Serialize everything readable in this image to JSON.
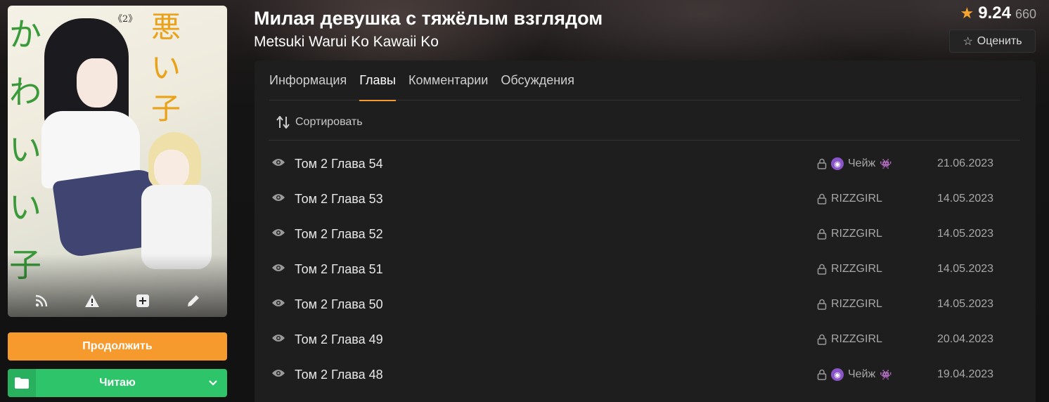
{
  "title": {
    "ru": "Милая девушка с тяжёлым взглядом",
    "en": "Metsuki Warui Ko Kawaii Ko"
  },
  "rating": {
    "score": "9.24",
    "count": "660",
    "rate_label": "Оценить"
  },
  "buttons": {
    "continue": "Продолжить",
    "reading": "Читаю"
  },
  "cover": {
    "icons": [
      "rss-icon",
      "report-icon",
      "add-icon",
      "edit-icon"
    ],
    "vol": "《2》"
  },
  "tabs": [
    {
      "label": "Информация",
      "active": false
    },
    {
      "label": "Главы",
      "active": true
    },
    {
      "label": "Комментарии",
      "active": false
    },
    {
      "label": "Обсуждения",
      "active": false
    }
  ],
  "sort_label": "Сортировать",
  "chapters": [
    {
      "name": "Том 2 Глава 54",
      "user": "Чейж",
      "date": "21.06.2023",
      "emoji": true
    },
    {
      "name": "Том 2 Глава 53",
      "user": "RIZZGIRL",
      "date": "14.05.2023",
      "emoji": false
    },
    {
      "name": "Том 2 Глава 52",
      "user": "RIZZGIRL",
      "date": "14.05.2023",
      "emoji": false
    },
    {
      "name": "Том 2 Глава 51",
      "user": "RIZZGIRL",
      "date": "14.05.2023",
      "emoji": false
    },
    {
      "name": "Том 2 Глава 50",
      "user": "RIZZGIRL",
      "date": "14.05.2023",
      "emoji": false
    },
    {
      "name": "Том 2 Глава 49",
      "user": "RIZZGIRL",
      "date": "20.04.2023",
      "emoji": false
    },
    {
      "name": "Том 2 Глава 48",
      "user": "Чейж",
      "date": "19.04.2023",
      "emoji": true
    }
  ],
  "colors": {
    "accent": "#f79a2e",
    "reading": "#2ec46a",
    "background": "#121212",
    "panel": "#1e1e1e"
  }
}
